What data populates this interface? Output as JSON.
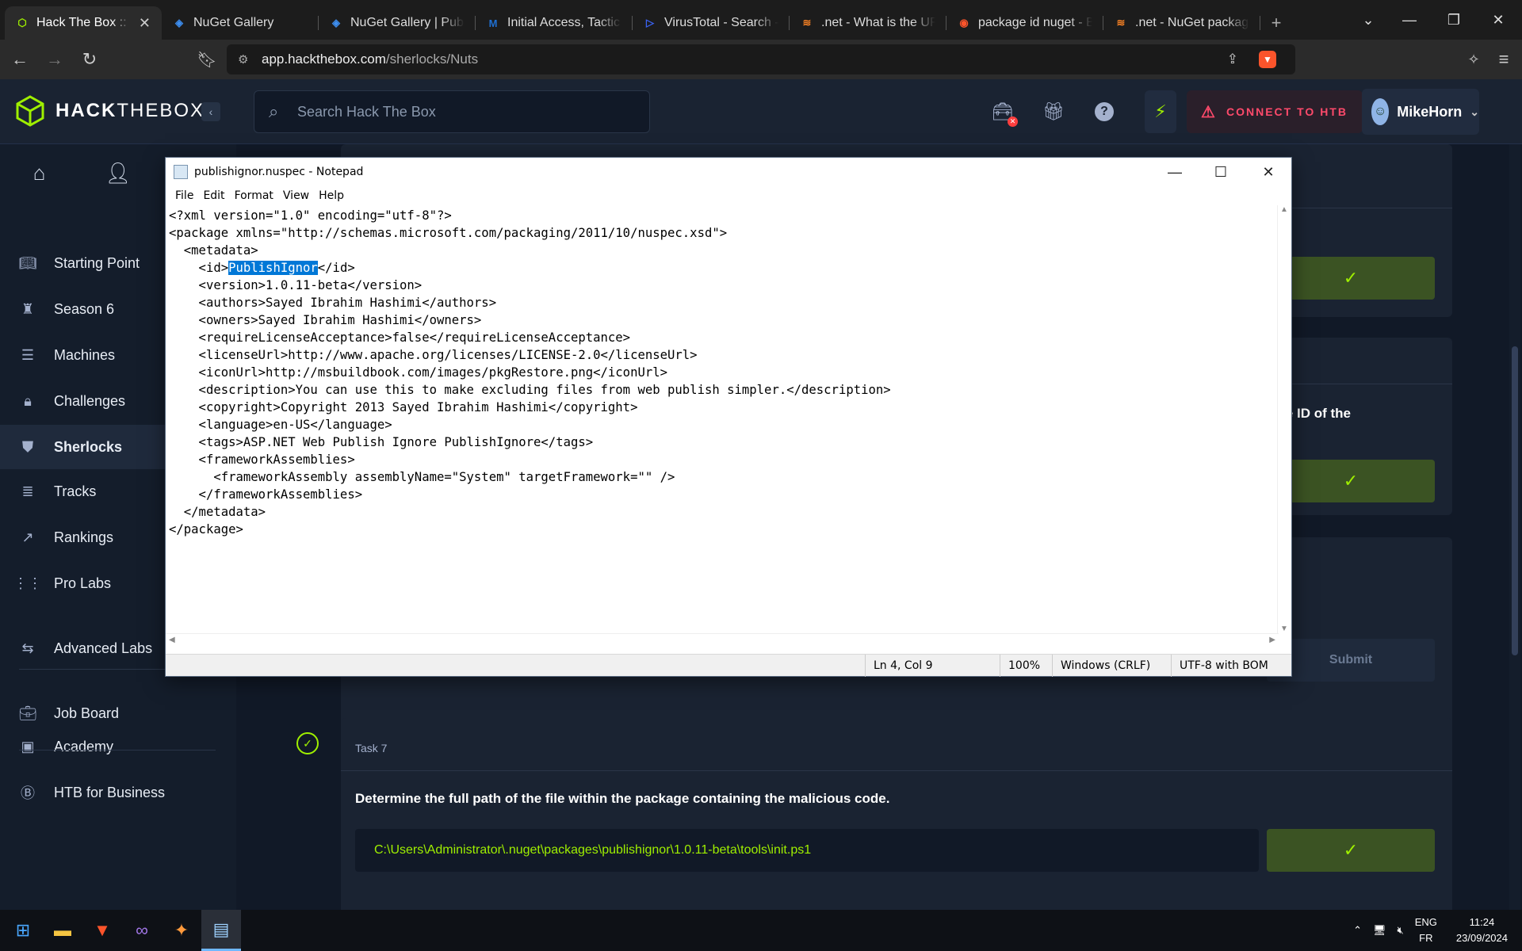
{
  "browser": {
    "tabs": [
      {
        "label": "Hack The Box :: H",
        "active": true,
        "icon": "htb-cube-icon"
      },
      {
        "label": "NuGet Gallery",
        "active": false,
        "icon": "nuget-icon"
      },
      {
        "label": "NuGet Gallery | Publi",
        "active": false,
        "icon": "nuget-icon"
      },
      {
        "label": "Initial Access, Tactic T",
        "active": false,
        "icon": "mitre-icon"
      },
      {
        "label": "VirusTotal - Search - ",
        "active": false,
        "icon": "virustotal-icon"
      },
      {
        "label": ".net - What is the UR",
        "active": false,
        "icon": "stackoverflow-icon"
      },
      {
        "label": "package id nuget - B",
        "active": false,
        "icon": "brave-search-icon"
      },
      {
        "label": ".net - NuGet package",
        "active": false,
        "icon": "stackoverflow-icon"
      }
    ],
    "url_host": "app.hackthebox.com",
    "url_path": "/sherlocks/Nuts"
  },
  "htb": {
    "brand_bold": "HACK",
    "brand_rest": "THEBOX",
    "search_placeholder": "Search Hack The Box",
    "connect_label": "CONNECT TO HTB",
    "username": "MikeHorn",
    "accent": "#9fef00"
  },
  "sidebar": {
    "items": [
      {
        "label": "Starting Point",
        "icon": "book-icon"
      },
      {
        "label": "Season 6",
        "icon": "castle-icon"
      },
      {
        "label": "Machines",
        "icon": "server-icon"
      },
      {
        "label": "Challenges",
        "icon": "lock-icon"
      },
      {
        "label": "Sherlocks",
        "icon": "shield-icon"
      },
      {
        "label": "Tracks",
        "icon": "stack-icon"
      },
      {
        "label": "Rankings",
        "icon": "trend-icon"
      },
      {
        "label": "Pro Labs",
        "icon": "labs-icon"
      },
      {
        "label": "Advanced Labs",
        "icon": "advanced-labs-icon"
      },
      {
        "label": "Job Board",
        "icon": "briefcase-icon"
      },
      {
        "label": "Academy",
        "icon": "terminal-icon"
      },
      {
        "label": "HTB for Business",
        "icon": "business-icon"
      }
    ]
  },
  "main": {
    "partial_question": "age ID of the",
    "submit_label": "Submit",
    "task7": {
      "label": "Task 7",
      "question": "Determine the full path of the file within the package containing the malicious code.",
      "answer": "C:\\Users\\Administrator\\.nuget\\packages\\publishignor\\1.0.11-beta\\tools\\init.ps1"
    }
  },
  "notepad": {
    "title": "publishignor.nuspec - Notepad",
    "menu": [
      "File",
      "Edit",
      "Format",
      "View",
      "Help"
    ],
    "lines": [
      "<?xml version=\"1.0\" encoding=\"utf-8\"?>",
      "<package xmlns=\"http://schemas.microsoft.com/packaging/2011/10/nuspec.xsd\">",
      "  <metadata>",
      "    <id>",
      "    <version>1.0.11-beta</version>",
      "    <authors>Sayed Ibrahim Hashimi</authors>",
      "    <owners>Sayed Ibrahim Hashimi</owners>",
      "    <requireLicenseAcceptance>false</requireLicenseAcceptance>",
      "    <licenseUrl>http://www.apache.org/licenses/LICENSE-2.0</licenseUrl>",
      "    <iconUrl>http://msbuildbook.com/images/pkgRestore.png</iconUrl>",
      "    <description>You can use this to make excluding files from web publish simpler.</description>",
      "    <copyright>Copyright 2013 Sayed Ibrahim Hashimi</copyright>",
      "    <language>en-US</language>",
      "    <tags>ASP.NET Web Publish Ignore PublishIgnore</tags>",
      "    <frameworkAssemblies>",
      "      <frameworkAssembly assemblyName=\"System\" targetFramework=\"\" />",
      "    </frameworkAssemblies>",
      "  </metadata>",
      "</package>"
    ],
    "selected_text": "PublishIgnor",
    "line4_suffix": "</id>",
    "status": {
      "position": "Ln 4, Col 9",
      "zoom": "100%",
      "line_endings": "Windows (CRLF)",
      "encoding": "UTF-8 with BOM"
    }
  },
  "taskbar": {
    "lang": "ENG",
    "layout": "FR",
    "time": "11:24",
    "date": "23/09/2024"
  }
}
